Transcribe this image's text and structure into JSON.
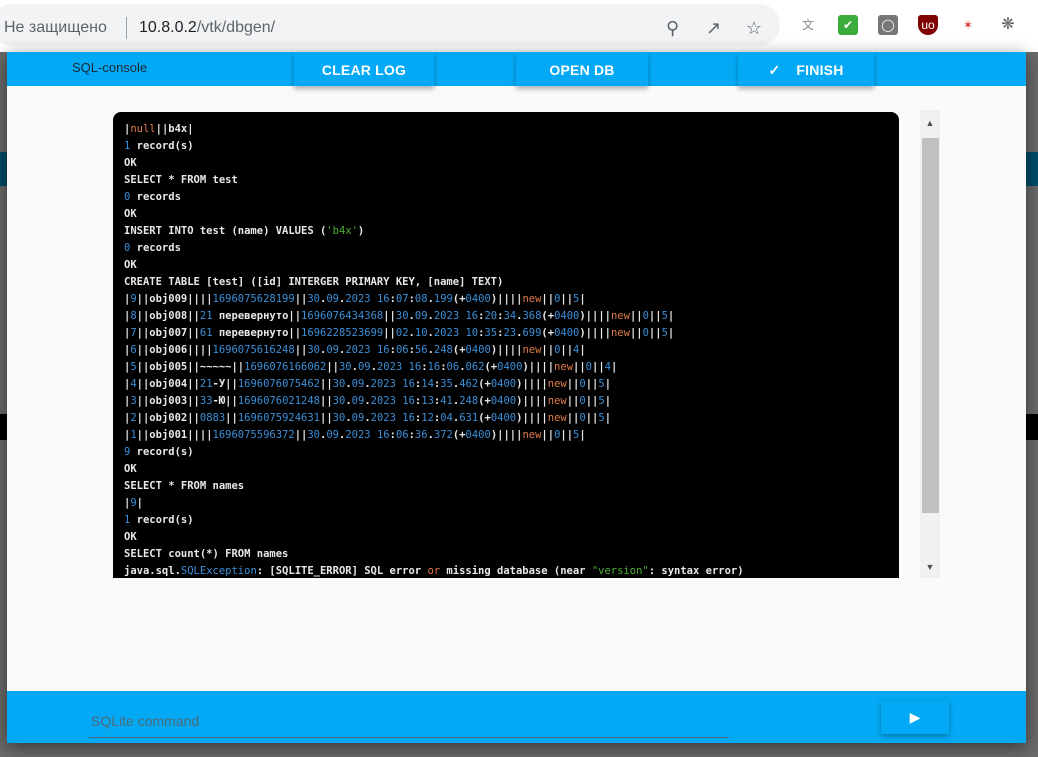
{
  "browser": {
    "security_label": "Не защищено",
    "url_host": "10.8.0.2",
    "url_path": "/vtk/dbgen/",
    "icons": [
      "zoom-icon",
      "share-icon",
      "bookmark-star-icon",
      "translate-icon",
      "checkmark-extension-icon",
      "tab-extension-icon",
      "ublock-icon",
      "star-extension-icon",
      "puzzle-extensions-icon"
    ]
  },
  "dialog": {
    "title": "SQL-console",
    "buttons": {
      "clear_log": "CLEAR LOG",
      "open_db": "OPEN DB",
      "finish": "FINISH"
    },
    "accent_color": "#03a9f4",
    "console_lines": [
      "|null||b4x|",
      "1 record(s)",
      "OK",
      "SELECT * FROM test",
      "0 records",
      "OK",
      "INSERT INTO test (name) VALUES ('b4x')",
      "0 records",
      "OK",
      "CREATE TABLE [test] ([id] INTERGER PRIMARY KEY, [name] TEXT)",
      "|9||obj009||||1696075628199||30.09.2023 16:07:08.199(+0400)||||new||0||5|",
      "|8||obj008||21 перевернуто||1696076434368||30.09.2023 16:20:34.368(+0400)||||new||0||5|",
      "|7||obj007||61 перевернуто||1696228523699||02.10.2023 10:35:23.699(+0400)||||new||0||5|",
      "|6||obj006||||1696075616248||30.09.2023 16:06:56.248(+0400)||||new||0||4|",
      "|5||obj005||~~~~~||1696076166062||30.09.2023 16:16:06.062(+0400)||||new||0||4|",
      "|4||obj004||21-У||1696076075462||30.09.2023 16:14:35.462(+0400)||||new||0||5|",
      "|3||obj003||33-Ю||1696076021248||30.09.2023 16:13:41.248(+0400)||||new||0||5|",
      "|2||obj002||0883||1696075924631||30.09.2023 16:12:04.631(+0400)||||new||0||5|",
      "|1||obj001||||1696075596372||30.09.2023 16:06:36.372(+0400)||||new||0||5|",
      "9 record(s)",
      "OK",
      "SELECT * FROM names",
      "|9|",
      "1 record(s)",
      "OK",
      "SELECT count(*) FROM names",
      "java.sql.SQLException: [SQLITE_ERROR] SQL error or missing database (near \"version\": syntax error)"
    ],
    "command_placeholder": "SQLite command",
    "command_value": "",
    "run_icon": "play-icon"
  }
}
